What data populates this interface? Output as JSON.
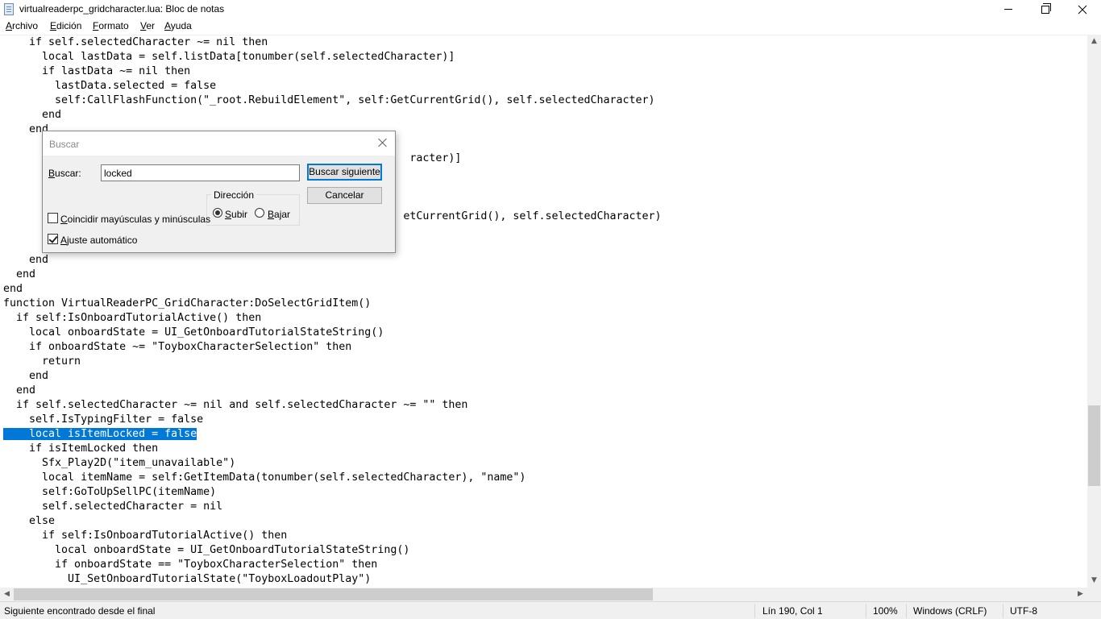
{
  "window": {
    "title": "virtualreaderpc_gridcharacter.lua: Bloc de notas",
    "app_icon": "notepad-icon",
    "controls": [
      "minimize-icon",
      "maximize-icon",
      "close-icon"
    ]
  },
  "menu": {
    "items": [
      "Archivo",
      "Edición",
      "Formato",
      "Ver",
      "Ayuda"
    ]
  },
  "editor": {
    "lines": [
      "    if self.selectedCharacter ~= nil then",
      "      local lastData = self.listData[tonumber(self.selectedCharacter)]",
      "      if lastData ~= nil then",
      "        lastData.selected = false",
      "        self:CallFlashFunction(\"_root.RebuildElement\", self:GetCurrentGrid(), self.selectedCharacter)",
      "      end",
      "    end",
      "",
      "                                                               racter)]",
      "",
      "",
      "",
      "                                                              etCurrentGrid(), self.selectedCharacter)",
      "",
      "",
      "    end",
      "  end",
      "end",
      "function VirtualReaderPC_GridCharacter:DoSelectGridItem()",
      "  if self:IsOnboardTutorialActive() then",
      "    local onboardState = UI_GetOnboardTutorialStateString()",
      "    if onboardState ~= \"ToyboxCharacterSelection\" then",
      "      return",
      "    end",
      "  end",
      "  if self.selectedCharacter ~= nil and self.selectedCharacter ~= \"\" then",
      "    self.IsTypingFilter = false",
      "    local isItemLocked = false",
      "    if isItemLocked then",
      "      Sfx_Play2D(\"item_unavailable\")",
      "      local itemName = self:GetItemData(tonumber(self.selectedCharacter), \"name\")",
      "      self:GoToUpSellPC(itemName)",
      "      self.selectedCharacter = nil",
      "    else",
      "      if self:IsOnboardTutorialActive() then",
      "        local onboardState = UI_GetOnboardTutorialStateString()",
      "        if onboardState == \"ToyboxCharacterSelection\" then",
      "          UI_SetOnboardTutorialState(\"ToyboxLoadoutPlay\")"
    ],
    "selected_line_index": 27
  },
  "find_dialog": {
    "title": "Buscar",
    "find_label": "Buscar:",
    "find_value": "locked",
    "find_next_label": "Buscar siguiente",
    "cancel_label": "Cancelar",
    "direction_label": "Dirección",
    "up_label": "Subir",
    "down_label": "Bajar",
    "direction_selected": "Subir",
    "match_case_label": "Coincidir mayúsculas y minúsculas",
    "match_case_checked": false,
    "wrap_label": "Ajuste automático",
    "wrap_checked": true
  },
  "statusbar": {
    "message": "Siguiente encontrado desde el final",
    "position": "Lín 190, Col 1",
    "zoom": "100%",
    "line_ending": "Windows (CRLF)",
    "encoding": "UTF-8"
  },
  "colors": {
    "selection": "#0078d7",
    "chrome": "#f0f0f0"
  }
}
